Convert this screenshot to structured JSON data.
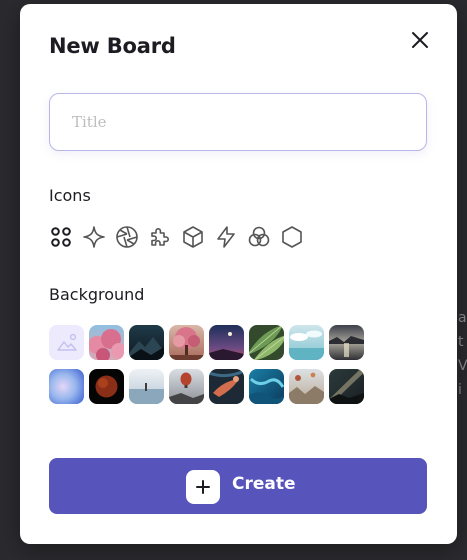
{
  "background_text": [
    "a",
    "t",
    "V",
    "i"
  ],
  "modal": {
    "title": "New Board",
    "close_icon": "close-icon",
    "title_input": {
      "value": "",
      "placeholder": "Title"
    },
    "icons_section": {
      "label": "Icons",
      "items": [
        "grid-dots-icon",
        "sparkle-icon",
        "aperture-icon",
        "puzzle-icon",
        "cube-icon",
        "lightning-icon",
        "circles-icon",
        "hexagon-icon"
      ]
    },
    "background_section": {
      "label": "Background",
      "rows": [
        [
          "image-placeholder",
          "cherry-blossoms",
          "night-mountain",
          "pink-tree",
          "moon-sky",
          "green-leaves",
          "sea-clouds",
          "lake-sunset"
        ],
        [
          "blue-gradient",
          "red-moon",
          "ocean-horizon",
          "hot-air-balloons",
          "swimmer-underwater",
          "coral-reef",
          "balloons-over-rocks",
          "milky-way"
        ]
      ]
    },
    "create_button": {
      "label": "Create",
      "icon": "plus-icon"
    }
  },
  "colors": {
    "accent": "#5754bb",
    "input_border": "#b9b6ea",
    "placeholder_tile": "#eceafc"
  }
}
